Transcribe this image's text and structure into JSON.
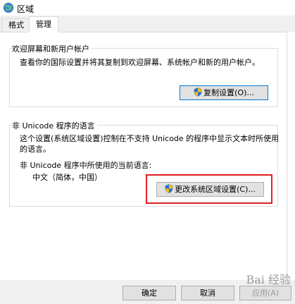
{
  "window": {
    "title": "区域"
  },
  "tabs": [
    {
      "label": "格式"
    },
    {
      "label": "管理"
    }
  ],
  "welcome_group": {
    "title": "欢迎屏幕和新用户帐户",
    "description": "查看你的国际设置并将其复制到欢迎屏幕、系统帐户和新的用户帐户。",
    "copy_button": "复制设置(O)..."
  },
  "unicode_group": {
    "title": "非 Unicode 程序的语言",
    "description_line1": "这个设置(系统区域设置)控制在不支持 Unicode 的程序中显示文本时所使用",
    "description_line2": "的语言。",
    "current_label": "非 Unicode 程序中所使用的当前语言:",
    "current_value": "中文（简体，中国）",
    "change_button": "更改系统区域设置(C)..."
  },
  "footer": {
    "ok": "确定",
    "cancel": "取消",
    "apply": "应用(A)"
  },
  "watermark": "Bai 经验",
  "colors": {
    "highlight": "#e02020",
    "tab_bg": "#f0f0f0",
    "button_bg": "#e1e1e1"
  },
  "icons": {
    "app": "globe-icon",
    "uac": "uac-shield-icon"
  }
}
